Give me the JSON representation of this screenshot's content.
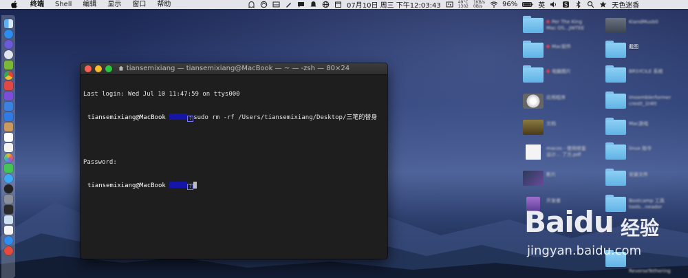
{
  "menubar": {
    "items": [
      "终端",
      "Shell",
      "编辑",
      "显示",
      "窗口",
      "帮助"
    ],
    "status": {
      "temp_top": "49°C",
      "temp_bottom": "1302",
      "net_up": "1KB/s",
      "net_down": "0B/s",
      "datetime": "07月10日 周三 下午12:03:43",
      "battery": "96%",
      "input_method": "英",
      "user": "天色迷香"
    }
  },
  "terminal": {
    "title": "tiansemixiang — tiansemixiang@MacBook — ~ — -zsh — 80×24",
    "lines": {
      "login": "Last login: Wed Jul 10 11:47:59 on ttys000",
      "prompt_user": "tiansemixiang@MacBook",
      "command": "sudo rm -rf /Users/tiansemixiang/Desktop/三笔的替身",
      "password": "Password:",
      "prompt_user2": "tiansemixiang@MacBook",
      "prompt_marker": "?"
    }
  },
  "desktop": {
    "items": [
      {
        "label": "Per The King",
        "label2": "Mac OS...JWTEE"
      },
      {
        "label": "KiandMusb0"
      },
      {
        "label": "Mac软件"
      },
      {
        "label": "截图"
      },
      {
        "label": "电脑图片"
      },
      {
        "label": "BRSYCILE 系统"
      },
      {
        "label": "应用程序"
      },
      {
        "label": "Imoemblerformer",
        "label2": "crestt_1t4tt"
      },
      {
        "label": "文档"
      },
      {
        "label": "Mac游戏"
      },
      {
        "label": "macos - 使用修复",
        "label2": "设计... 了方.pdf"
      },
      {
        "label": "linux 指令"
      },
      {
        "label": "影片"
      },
      {
        "label": "安装文件"
      },
      {
        "label": "开发者"
      },
      {
        "label": "Bootcamp 工具",
        "label2": "tools...neador"
      },
      {
        "label": "ReverseTethering"
      }
    ]
  },
  "watermark": {
    "logo": "Baidu",
    "logo_cn": "经验",
    "url": "jingyan.baidu.com"
  },
  "colors": {
    "terminal_bg": "#1e1e1e",
    "prompt_highlight": "#1515a8",
    "traffic_red": "#fc5f57",
    "traffic_yellow": "#fdbc2e",
    "traffic_green": "#28c840"
  }
}
